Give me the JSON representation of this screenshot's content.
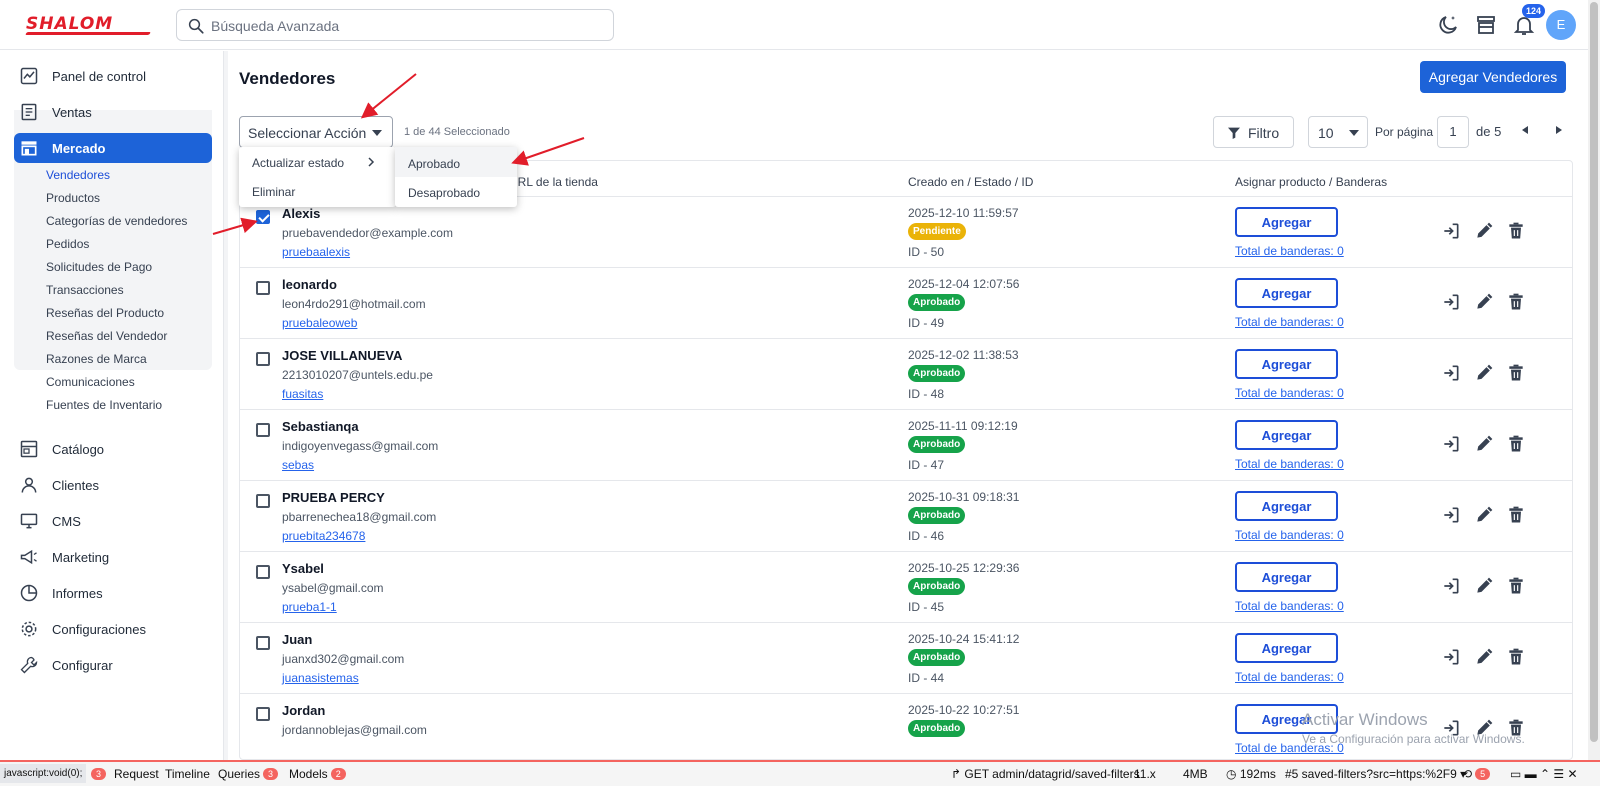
{
  "header": {
    "logo_text": "SHALOM",
    "search_placeholder": "Búsqueda Avanzada",
    "notification_count": "124",
    "avatar_initial": "E"
  },
  "sidebar": {
    "items": [
      {
        "label": "Panel de control",
        "icon": "dashboard-icon"
      },
      {
        "label": "Ventas",
        "icon": "receipt-icon"
      },
      {
        "label": "Mercado",
        "icon": "store-icon"
      },
      {
        "label": "Catálogo",
        "icon": "catalog-icon"
      },
      {
        "label": "Clientes",
        "icon": "user-icon"
      },
      {
        "label": "CMS",
        "icon": "desktop-icon"
      },
      {
        "label": "Marketing",
        "icon": "megaphone-icon"
      },
      {
        "label": "Informes",
        "icon": "chart-pie-icon"
      },
      {
        "label": "Configuraciones",
        "icon": "gear-icon"
      },
      {
        "label": "Configurar",
        "icon": "wrench-icon"
      }
    ],
    "submenu": [
      "Vendedores",
      "Productos",
      "Categorías de vendedores",
      "Pedidos",
      "Solicitudes de Pago",
      "Transacciones",
      "Reseñas del Producto",
      "Reseñas del Vendedor",
      "Razones de Marca",
      "Comunicaciones",
      "Fuentes de Inventario"
    ]
  },
  "page": {
    "title": "Vendedores",
    "add_button": "Agregar Vendedores",
    "action_select": "Seleccionar Acción",
    "selection_count": "1 de 44 Seleccionado",
    "filter_label": "Filtro",
    "per_page_value": "10",
    "per_page_label": "Por página",
    "current_page": "1",
    "total_pages_label": "de 5"
  },
  "action_menu": {
    "items": [
      "Actualizar estado",
      "Eliminar"
    ],
    "submenu": [
      "Aprobado",
      "Desaprobado"
    ]
  },
  "table": {
    "headers": {
      "store_url": "URL de la tienda",
      "created": "Creado en / Estado / ID",
      "assign": "Asignar producto / Banderas"
    },
    "rows": [
      {
        "name": "Alexis",
        "email": "pruebavendedor@example.com",
        "url": "pruebaalexis",
        "date": "2025-12-10 11:59:57",
        "status": "Pendiente",
        "id": "ID - 50",
        "add": "Agregar",
        "flags": "Total de banderas: 0",
        "checked": true
      },
      {
        "name": "leonardo",
        "email": "leon4rdo291@hotmail.com",
        "url": "pruebaleoweb",
        "date": "2025-12-04 12:07:56",
        "status": "Aprobado",
        "id": "ID - 49",
        "add": "Agregar",
        "flags": "Total de banderas: 0",
        "checked": false
      },
      {
        "name": "JOSE VILLANUEVA",
        "email": "2213010207@untels.edu.pe",
        "url": "fuasitas",
        "date": "2025-12-02 11:38:53",
        "status": "Aprobado",
        "id": "ID - 48",
        "add": "Agregar",
        "flags": "Total de banderas: 0",
        "checked": false
      },
      {
        "name": "Sebastianqa",
        "email": "indigoyenvegass@gmail.com",
        "url": "sebas",
        "date": "2025-11-11 09:12:19",
        "status": "Aprobado",
        "id": "ID - 47",
        "add": "Agregar",
        "flags": "Total de banderas: 0",
        "checked": false
      },
      {
        "name": "PRUEBA PERCY",
        "email": "pbarrenechea18@gmail.com",
        "url": "pruebita234678",
        "date": "2025-10-31 09:18:31",
        "status": "Aprobado",
        "id": "ID - 46",
        "add": "Agregar",
        "flags": "Total de banderas: 0",
        "checked": false
      },
      {
        "name": "Ysabel",
        "email": "ysabel@gmail.com",
        "url": "prueba1-1",
        "date": "2025-10-25 12:29:36",
        "status": "Aprobado",
        "id": "ID - 45",
        "add": "Agregar",
        "flags": "Total de banderas: 0",
        "checked": false
      },
      {
        "name": "Juan",
        "email": "juanxd302@gmail.com",
        "url": "juanasistemas",
        "date": "2025-10-24 15:41:12",
        "status": "Aprobado",
        "id": "ID - 44",
        "add": "Agregar",
        "flags": "Total de banderas: 0",
        "checked": false
      },
      {
        "name": "Jordan",
        "email": "jordannoblejas@gmail.com",
        "url": "",
        "date": "2025-10-22 10:27:51",
        "status": "Aprobado",
        "id": "",
        "add": "Agregar",
        "flags": "Total de banderas: 0",
        "checked": false
      }
    ]
  },
  "status_colors": {
    "Pendiente": "#eab308",
    "Aprobado": "#16a34a"
  },
  "watermark": {
    "line1": "Activar Windows",
    "line2": "Ve a Configuración para activar Windows."
  },
  "debugbar": {
    "js_void": "javascript:void(0);",
    "js_count": "3",
    "request": "Request",
    "timeline": "Timeline",
    "queries": "Queries",
    "queries_count": "3",
    "models": "Models",
    "models_count": "2",
    "route": "GET admin/datagrid/saved-filters",
    "laravel_version": "11.x",
    "memory": "4MB",
    "time": "192ms",
    "request_id": "#5 saved-filters?src=https:%2F9",
    "history_count": "5"
  }
}
